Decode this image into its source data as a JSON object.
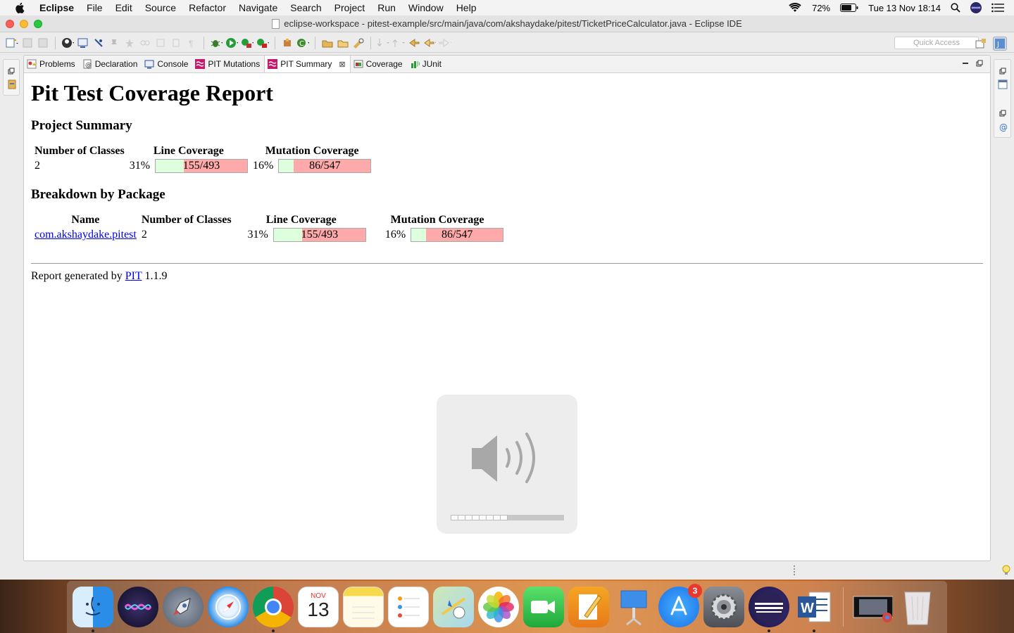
{
  "menubar": {
    "app_name": "Eclipse",
    "items": [
      "File",
      "Edit",
      "Source",
      "Refactor",
      "Navigate",
      "Search",
      "Project",
      "Run",
      "Window",
      "Help"
    ],
    "battery": "72%",
    "datetime": "Tue 13 Nov  18:14"
  },
  "window": {
    "title": "eclipse-workspace - pitest-example/src/main/java/com/akshaydake/pitest/TicketPriceCalculator.java - Eclipse IDE"
  },
  "toolbar": {
    "quick_access_placeholder": "Quick Access"
  },
  "tabs": [
    {
      "label": "Problems",
      "icon": "problems-icon",
      "active": false
    },
    {
      "label": "Declaration",
      "icon": "declaration-icon",
      "active": false
    },
    {
      "label": "Console",
      "icon": "console-icon",
      "active": false
    },
    {
      "label": "PIT Mutations",
      "icon": "pit-icon",
      "active": false
    },
    {
      "label": "PIT Summary",
      "icon": "pit-icon",
      "active": true
    },
    {
      "label": "Coverage",
      "icon": "coverage-icon",
      "active": false
    },
    {
      "label": "JUnit",
      "icon": "junit-icon",
      "active": false
    }
  ],
  "report": {
    "title": "Pit Test Coverage Report",
    "project_summary_heading": "Project Summary",
    "summary_headers": {
      "classes": "Number of Classes",
      "line": "Line Coverage",
      "mutation": "Mutation Coverage"
    },
    "summary": {
      "classes": "2",
      "line_pct": "31%",
      "line_fraction": 0.31,
      "line_text": "155/493",
      "mutation_pct": "16%",
      "mutation_fraction": 0.16,
      "mutation_text": "86/547"
    },
    "breakdown_heading": "Breakdown by Package",
    "breakdown_headers": {
      "name": "Name",
      "classes": "Number of Classes",
      "line": "Line Coverage",
      "mutation": "Mutation Coverage"
    },
    "packages": [
      {
        "name": "com.akshaydake.pitest",
        "classes": "2",
        "line_pct": "31%",
        "line_fraction": 0.31,
        "line_text": "155/493",
        "mutation_pct": "16%",
        "mutation_fraction": 0.16,
        "mutation_text": "86/547"
      }
    ],
    "footer_prefix": "Report generated by ",
    "footer_link": "PIT",
    "footer_suffix": " 1.1.9"
  },
  "volume_hud": {
    "level": 0.5
  },
  "dock": {
    "calendar_month": "NOV",
    "calendar_day": "13",
    "app_store_badge": "3",
    "apps": [
      "finder",
      "siri",
      "launchpad",
      "safari",
      "chrome",
      "calendar",
      "notes",
      "reminders",
      "maps",
      "photos",
      "facetime",
      "pages",
      "keynote",
      "app-store",
      "system-preferences",
      "eclipse",
      "word",
      "screenshot-preview",
      "trash"
    ]
  },
  "colors": {
    "covered": "#ddffdd",
    "uncovered": "#ffaaaa",
    "link": "#0000ee"
  }
}
